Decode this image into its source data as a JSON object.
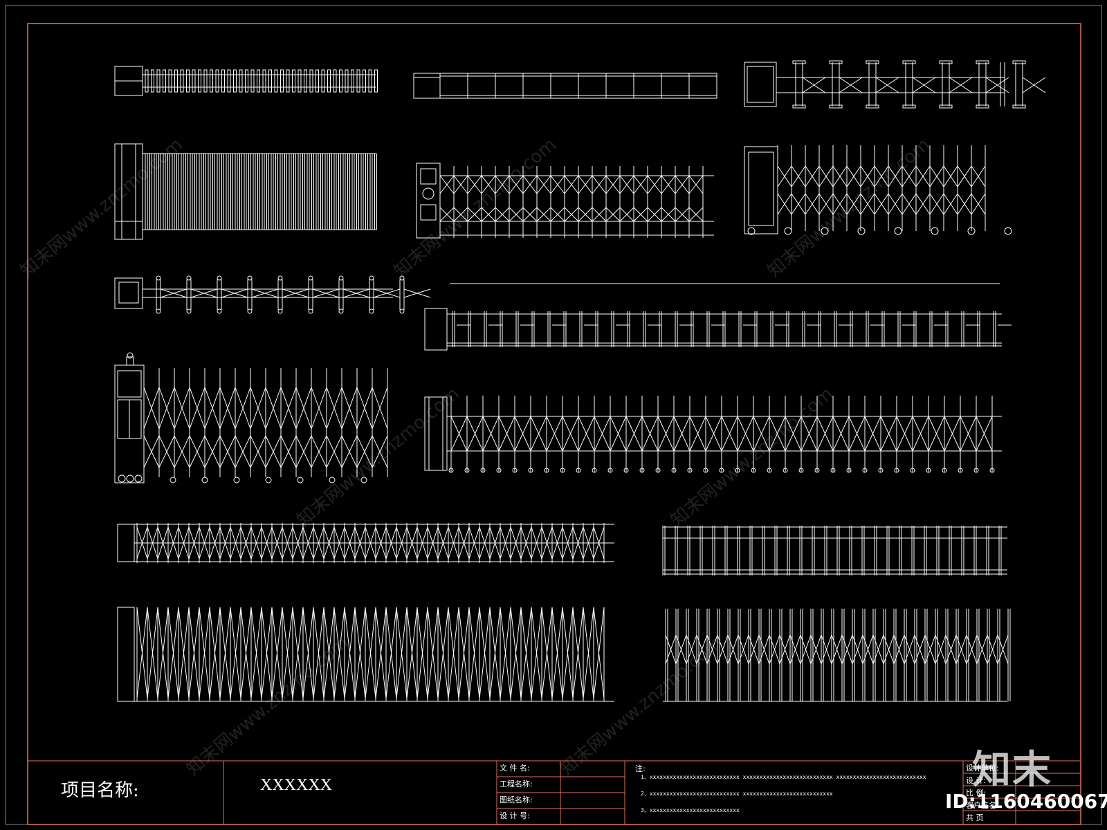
{
  "colors": {
    "background": "#000000",
    "frame": "#e0735a",
    "lines": "#ffffff"
  },
  "title_block": {
    "project_label": "项目名称:",
    "project_value": "XXXXXX",
    "fields": [
      "文 件 名:",
      "工程名称:",
      "图纸名称:",
      "设 计 号:"
    ],
    "note_title": "注:",
    "notes": [
      "1、xxxxxxxxxxxxxxxxxxxxxxxxxxx    xxxxxxxxxxxxxxxxxxxxxxxxxxx    xxxxxxxxxxxxxxxxxxxxxxxxxxx",
      "2、xxxxxxxxxxxxxxxxxxxxxxxxxxx    xxxxxxxxxxxxxxxxxxxxxxxxxxx",
      "3、xxxxxxxxxxxxxxxxxxxxxxxxxxx"
    ],
    "right_fields": [
      "设计单位:",
      "设    计:",
      "比    例:",
      "客户签名:",
      "共    页"
    ]
  },
  "watermark": {
    "brand": "知末",
    "id": "ID:1160460067",
    "text": "知末网www.znzmo.com"
  }
}
